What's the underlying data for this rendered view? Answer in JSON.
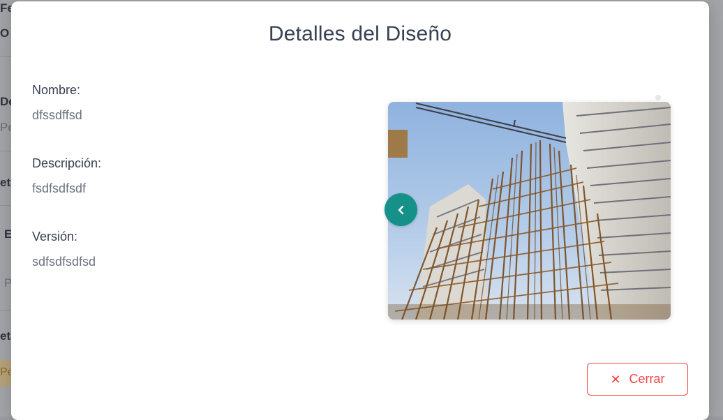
{
  "background": {
    "fragments": [
      "Fe",
      "O",
      "De",
      "Pe",
      "eta",
      "E",
      "P",
      "eta",
      "Pe"
    ]
  },
  "modal": {
    "title": "Detalles del Diseño",
    "fields": [
      {
        "label": "Nombre:",
        "value": "dfssdffsd"
      },
      {
        "label": "Descripción:",
        "value": "fsdfsdfsdf"
      },
      {
        "label": "Versión:",
        "value": "sdfsdfsdfsd"
      }
    ],
    "carousel": {
      "prev_icon": "chevron-left-icon"
    },
    "close_button": {
      "icon": "close-icon",
      "icon_glyph": "✕",
      "label": "Cerrar"
    }
  },
  "colors": {
    "accent": "#15918a",
    "danger": "#ef4444"
  }
}
